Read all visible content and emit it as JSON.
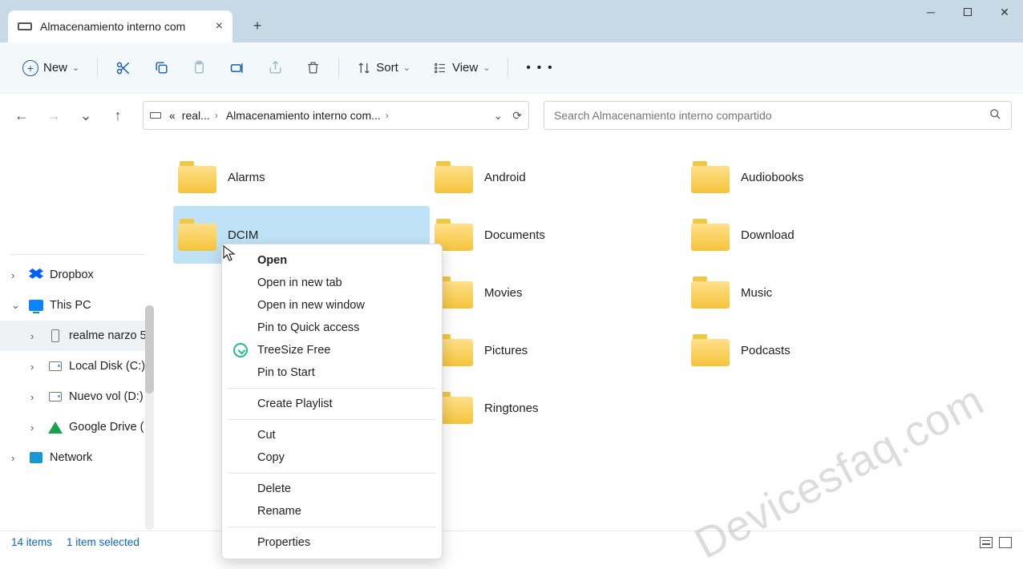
{
  "window": {
    "tab_title": "Almacenamiento interno com",
    "close_glyph": "×",
    "plus_glyph": "+"
  },
  "toolbar": {
    "new_label": "New",
    "sort_label": "Sort",
    "view_label": "View",
    "ellipsis": "• • •"
  },
  "address": {
    "segments": [
      "«",
      "real...",
      "Almacenamiento interno com..."
    ],
    "refresh_glyph": "⟳"
  },
  "search": {
    "placeholder": "Search Almacenamiento interno compartido"
  },
  "sidebar": {
    "dropbox": "Dropbox",
    "this_pc": "This PC",
    "realme": "realme narzo 5",
    "local_disk": "Local Disk (C:)",
    "nuevo_vol": "Nuevo vol (D:)",
    "google_drive": "Google Drive (",
    "network": "Network"
  },
  "folders": [
    "Alarms",
    "Android",
    "Audiobooks",
    "DCIM",
    "Documents",
    "Download",
    "",
    "Movies",
    "Music",
    "",
    "Pictures",
    "Podcasts",
    "",
    "Ringtones",
    ""
  ],
  "selected_folder_index": 3,
  "context_menu": {
    "open": "Open",
    "open_new_tab": "Open in new tab",
    "open_new_window": "Open in new window",
    "pin_quick": "Pin to Quick access",
    "treesize": "TreeSize Free",
    "pin_start": "Pin to Start",
    "create_playlist": "Create Playlist",
    "cut": "Cut",
    "copy": "Copy",
    "delete": "Delete",
    "rename": "Rename",
    "properties": "Properties"
  },
  "status": {
    "item_count": "14 items",
    "selection": "1 item selected"
  },
  "watermark": "Devicesfaq.com"
}
